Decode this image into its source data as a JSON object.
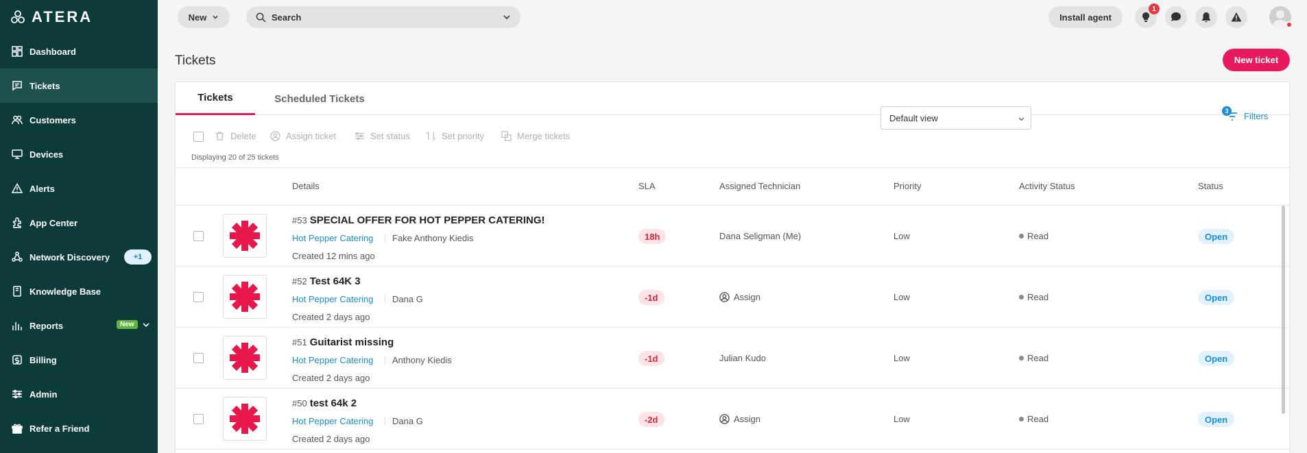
{
  "app": {
    "logo_text": "ATERA"
  },
  "sidebar": {
    "items": [
      {
        "label": "Dashboard",
        "icon": "dashboard-icon"
      },
      {
        "label": "Tickets",
        "icon": "tickets-icon",
        "active": true
      },
      {
        "label": "Customers",
        "icon": "customers-icon"
      },
      {
        "label": "Devices",
        "icon": "devices-icon"
      },
      {
        "label": "Alerts",
        "icon": "alerts-icon"
      },
      {
        "label": "App Center",
        "icon": "app-center-icon"
      },
      {
        "label": "Network Discovery",
        "icon": "network-discovery-icon",
        "badge": "+1"
      },
      {
        "label": "Knowledge Base",
        "icon": "knowledge-base-icon"
      },
      {
        "label": "Reports",
        "icon": "reports-icon",
        "badge": "New"
      },
      {
        "label": "Billing",
        "icon": "billing-icon"
      },
      {
        "label": "Admin",
        "icon": "admin-icon"
      },
      {
        "label": "Refer a Friend",
        "icon": "gift-icon"
      }
    ]
  },
  "topbar": {
    "new_label": "New",
    "search_placeholder": "Search",
    "install_label": "Install agent",
    "notification_count": "1"
  },
  "page": {
    "title": "Tickets",
    "new_ticket_label": "New ticket"
  },
  "tabs": [
    {
      "label": "Tickets",
      "active": true
    },
    {
      "label": "Scheduled Tickets",
      "active": false
    }
  ],
  "toolbar": {
    "delete": "Delete",
    "assign": "Assign ticket",
    "set_status": "Set status",
    "set_priority": "Set priority",
    "merge": "Merge tickets",
    "displaying": "Displaying 20 of 25 tickets",
    "view": "Default view",
    "filters": "Filters",
    "filter_count": "3"
  },
  "table": {
    "headers": [
      "Details",
      "SLA",
      "Assigned Technician",
      "Priority",
      "Activity Status",
      "Status"
    ],
    "rows": [
      {
        "number": "#53",
        "title": "SPECIAL OFFER FOR HOT PEPPER CATERING!",
        "customer": "Hot Pepper Catering",
        "contact": "Fake Anthony Kiedis",
        "created": "Created 12 mins ago",
        "sla": "18h",
        "technician": "Dana Seligman (Me)",
        "priority": "Low",
        "activity": "Read",
        "status": "Open"
      },
      {
        "number": "#52",
        "title": "Test 64K 3",
        "customer": "Hot Pepper Catering",
        "contact": "Dana G",
        "created": "Created 2 days ago",
        "sla": "-1d",
        "technician": "Assign",
        "priority": "Low",
        "activity": "Read",
        "status": "Open"
      },
      {
        "number": "#51",
        "title": "Guitarist missing",
        "customer": "Hot Pepper Catering",
        "contact": "Anthony Kiedis",
        "created": "Created 2 days ago",
        "sla": "-1d",
        "technician": "Julian Kudo",
        "priority": "Low",
        "activity": "Read",
        "status": "Open"
      },
      {
        "number": "#50",
        "title": "test 64k 2",
        "customer": "Hot Pepper Catering",
        "contact": "Dana G",
        "created": "Created 2 days ago",
        "sla": "-2d",
        "technician": "Assign",
        "priority": "Low",
        "activity": "Read",
        "status": "Open"
      }
    ]
  },
  "colors": {
    "sidebar": "#0d3b3a",
    "accent": "#e8195d",
    "link": "#1a8fd8"
  }
}
